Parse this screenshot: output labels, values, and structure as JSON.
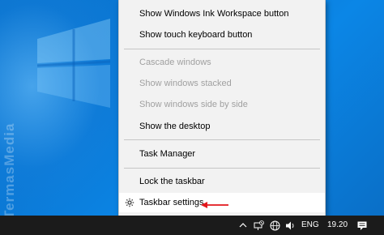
{
  "context_menu": {
    "items": [
      {
        "label": "Show Windows Ink Workspace button",
        "enabled": true
      },
      {
        "label": "Show touch keyboard button",
        "enabled": true
      },
      {
        "label": "Cascade windows",
        "enabled": false
      },
      {
        "label": "Show windows stacked",
        "enabled": false
      },
      {
        "label": "Show windows side by side",
        "enabled": false
      },
      {
        "label": "Show the desktop",
        "enabled": true
      },
      {
        "label": "Task Manager",
        "enabled": true
      },
      {
        "label": "Lock the taskbar",
        "enabled": true
      },
      {
        "label": "Taskbar settings",
        "enabled": true,
        "icon": "gear-icon"
      }
    ]
  },
  "watermark": "TermasMedia",
  "taskbar": {
    "language": "ENG",
    "clock": "19.20",
    "tray_icons": [
      "chevron-up-icon",
      "network-disconnected-icon",
      "globe-icon",
      "volume-icon",
      "notification-icon"
    ]
  },
  "colors": {
    "desktop_accent": "#0a74cf",
    "menu_background": "#f2f2f2",
    "taskbar": "#1b1b1b",
    "annotation_arrow": "#e3161b"
  }
}
